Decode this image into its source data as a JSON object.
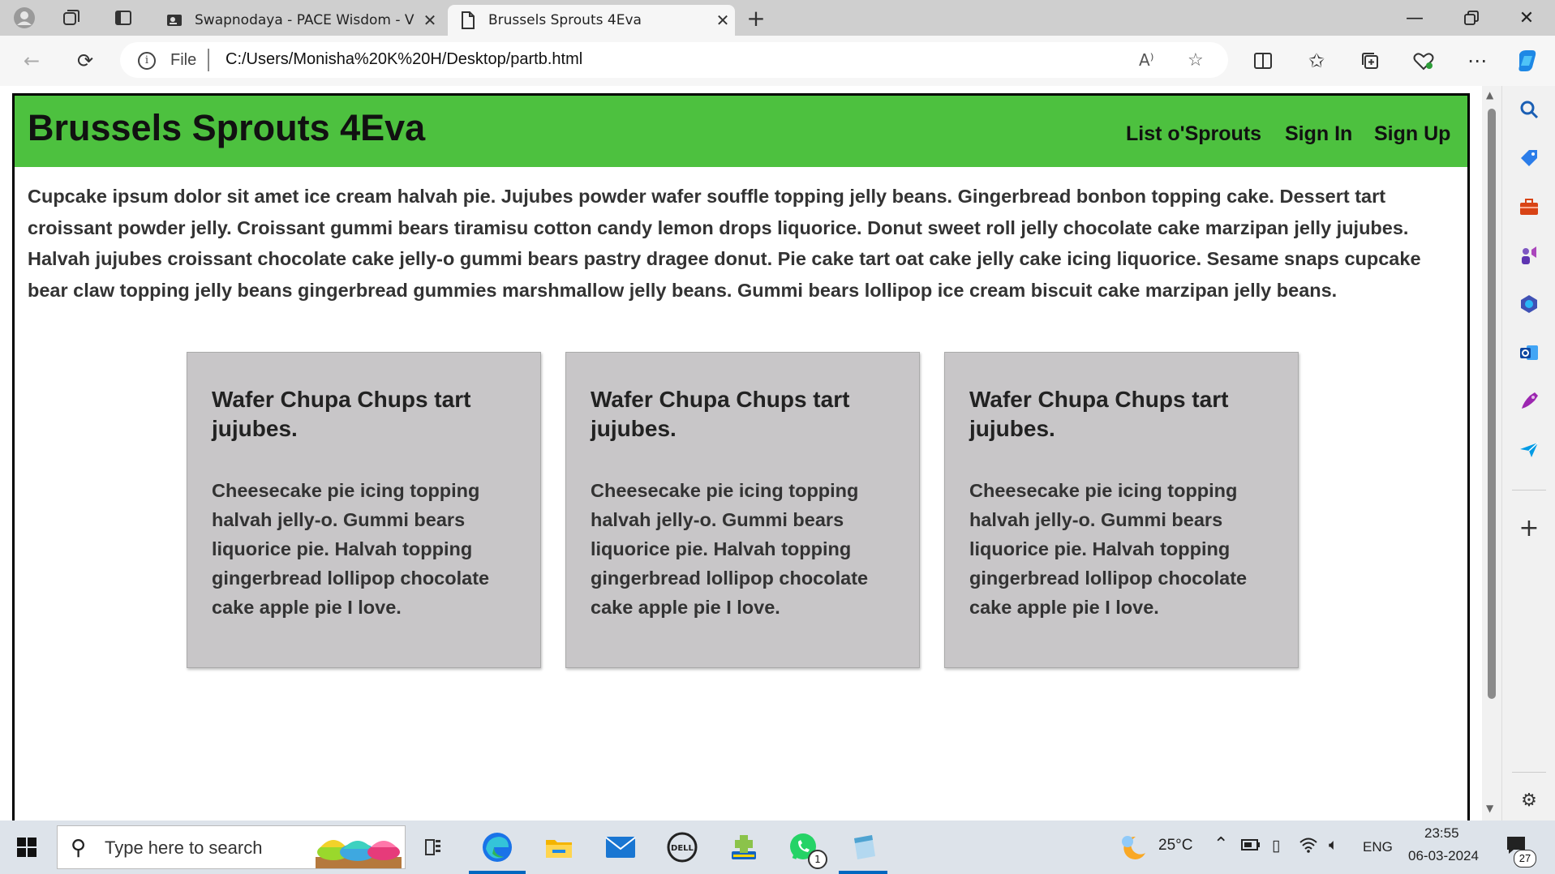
{
  "browser": {
    "tabs": [
      {
        "title": "Swapnodaya - PACE Wisdom - V",
        "active": false
      },
      {
        "title": "Brussels Sprouts 4Eva",
        "active": true
      }
    ],
    "new_tab_icon": "plus-icon",
    "address": {
      "scheme_label": "File",
      "url": "C:/Users/Monisha%20K%20H/Desktop/partb.html"
    }
  },
  "page": {
    "brand": "Brussels Sprouts 4Eva",
    "nav": [
      "List o'Sprouts",
      "Sign In",
      "Sign Up"
    ],
    "intro": "Cupcake ipsum dolor sit amet ice cream halvah pie. Jujubes powder wafer souffle topping jelly beans. Gingerbread bonbon topping cake. Dessert tart croissant powder jelly. Croissant gummi bears tiramisu cotton candy lemon drops liquorice. Donut sweet roll jelly chocolate cake marzipan jelly jujubes. Halvah jujubes croissant chocolate cake jelly-o gummi bears pastry dragee donut. Pie cake tart oat cake jelly cake icing liquorice. Sesame snaps cupcake bear claw topping jelly beans gingerbread gummies marshmallow jelly beans. Gummi bears lollipop ice cream biscuit cake marzipan jelly beans.",
    "cards": [
      {
        "title": "Wafer Chupa Chups tart jujubes.",
        "body": "Cheesecake pie icing topping halvah jelly-o. Gummi bears liquorice pie. Halvah topping gingerbread lollipop chocolate cake apple pie I love."
      },
      {
        "title": "Wafer Chupa Chups tart jujubes.",
        "body": "Cheesecake pie icing topping halvah jelly-o. Gummi bears liquorice pie. Halvah topping gingerbread lollipop chocolate cake apple pie I love."
      },
      {
        "title": "Wafer Chupa Chups tart jujubes.",
        "body": "Cheesecake pie icing topping halvah jelly-o. Gummi bears liquorice pie. Halvah topping gingerbread lollipop chocolate cake apple pie I love."
      }
    ],
    "colors": {
      "header_green": "#4dc13f",
      "card_gray": "#c8c6c8"
    }
  },
  "taskbar": {
    "search_placeholder": "Type here to search",
    "weather": "25°C",
    "language": "ENG",
    "time": "23:55",
    "date": "06-03-2024",
    "whatsapp_badge": "1",
    "notification_count": "27"
  }
}
